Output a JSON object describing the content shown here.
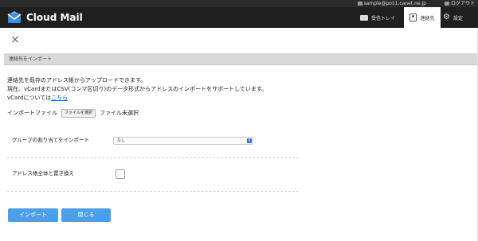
{
  "topbar": {
    "user_email": "sample@po11.canet.ne.jp",
    "logout_label": "ログアウト"
  },
  "header": {
    "brand": "Cloud Mail",
    "nav": {
      "inbox_label": "受信トレイ",
      "contacts_label": "連絡先",
      "settings_label": "設定"
    }
  },
  "dialog": {
    "close_icon": "×",
    "section_title": "連絡先をインポート",
    "description": {
      "line1": "連絡先を既存のアドレス帳からアップロードできます。",
      "line2": "現在、vCardまたはCSV(コンマ区切り)のデータ形式からアドレスのインポートをサポートしています。",
      "line3_prefix": "vCardについては",
      "line3_link": "こちら"
    },
    "file": {
      "label": "インポートファイル",
      "button_label": "ファイルを選択",
      "status": "ファイル未選択"
    },
    "group": {
      "label": "グループの割り当てをインポート",
      "selected": "なし"
    },
    "replace": {
      "label": "アドレス帳全体と置き換え",
      "checked": false
    },
    "buttons": {
      "import_label": "インポート",
      "close_label": "閉じる"
    }
  },
  "colors": {
    "header_bg": "#1f1f1f",
    "accent": "#4a9fea",
    "section_bar": "#d9d9d9",
    "link": "#1b5fbf"
  },
  "icons": {
    "logo": "mail-envelope-icon",
    "inbox": "mail-icon",
    "contacts": "contacts-icon",
    "settings": "gear-icon",
    "close": "close-icon",
    "select": "chevron-updown-icon"
  }
}
